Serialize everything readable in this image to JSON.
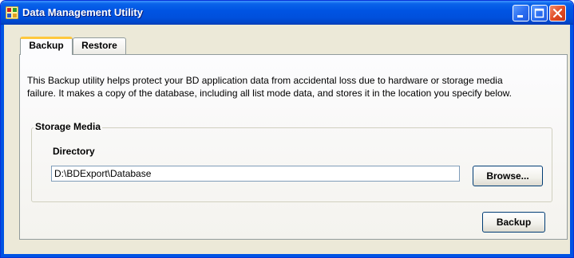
{
  "window": {
    "title": "Data Management Utility"
  },
  "tabs": [
    {
      "label": "Backup",
      "active": true
    },
    {
      "label": "Restore",
      "active": false
    }
  ],
  "description": {
    "line1": "This Backup utility helps protect your BD application data from accidental loss due to hardware or storage media",
    "line2": "failure. It makes a copy of the database, including all list mode data, and stores it in the location you specify below."
  },
  "storage": {
    "group_title": "Storage Media",
    "directory_label": "Directory",
    "directory_value": "D:\\BDExport\\Database",
    "browse_label": "Browse..."
  },
  "actions": {
    "backup_label": "Backup"
  },
  "colors": {
    "titlebar": "#0054e3",
    "tab_highlight": "#ffc83c",
    "panel_border": "#919b9c"
  },
  "icons": {
    "app": "app-icon",
    "minimize": "minimize-icon",
    "maximize": "maximize-icon",
    "close": "close-icon"
  }
}
